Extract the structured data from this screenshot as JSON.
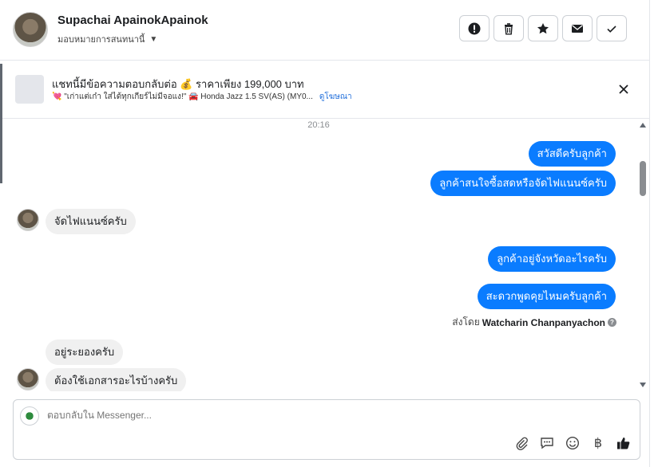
{
  "header": {
    "contact_name": "Supachai ApainokApainok",
    "assign_label": "มอบหมายการสนทนานี้",
    "buttons": [
      "mark-spam",
      "delete",
      "star",
      "mark-unread",
      "done"
    ]
  },
  "ad": {
    "title": "แชทนี้มีข้อความตอบกลับต่อ 💰 ราคาเพียง 199,000 บาท",
    "subtitle": "💘 \"เก่าแต่เก๋า ใส่ได้ทุกเกียร์ไม่มีจอแง!\" 🚘 Honda Jazz 1.5 SV(AS) (MY0...",
    "link_label": "ดูโฆษณา"
  },
  "messages": {
    "timestamp": "20:16",
    "m1": "สวัสดีครับลูกค้า",
    "m2": "ลูกค้าสนใจซื้อสดหรือจัดไฟแนนซ์ครับ",
    "m3": "จัดไฟแนนซ์ครับ",
    "m4": "ลูกค้าอยู่จังหวัดอะไรครับ",
    "m5": "สะดวกพูดคุยไหมครับลูกค้า",
    "sent_by_prefix": "ส่งโดย",
    "sent_by_name": "Watcharin Chanpanyachon",
    "m6": "อยู่ระยองครับ",
    "m7": "ต้องใช้เอกสารอะไรบ้างครับ"
  },
  "composer": {
    "placeholder": "ตอบกลับใน Messenger..."
  },
  "colors": {
    "outgoing_bubble": "#0a7cff",
    "incoming_bubble": "#f0f0f0",
    "link": "#216fdb"
  }
}
